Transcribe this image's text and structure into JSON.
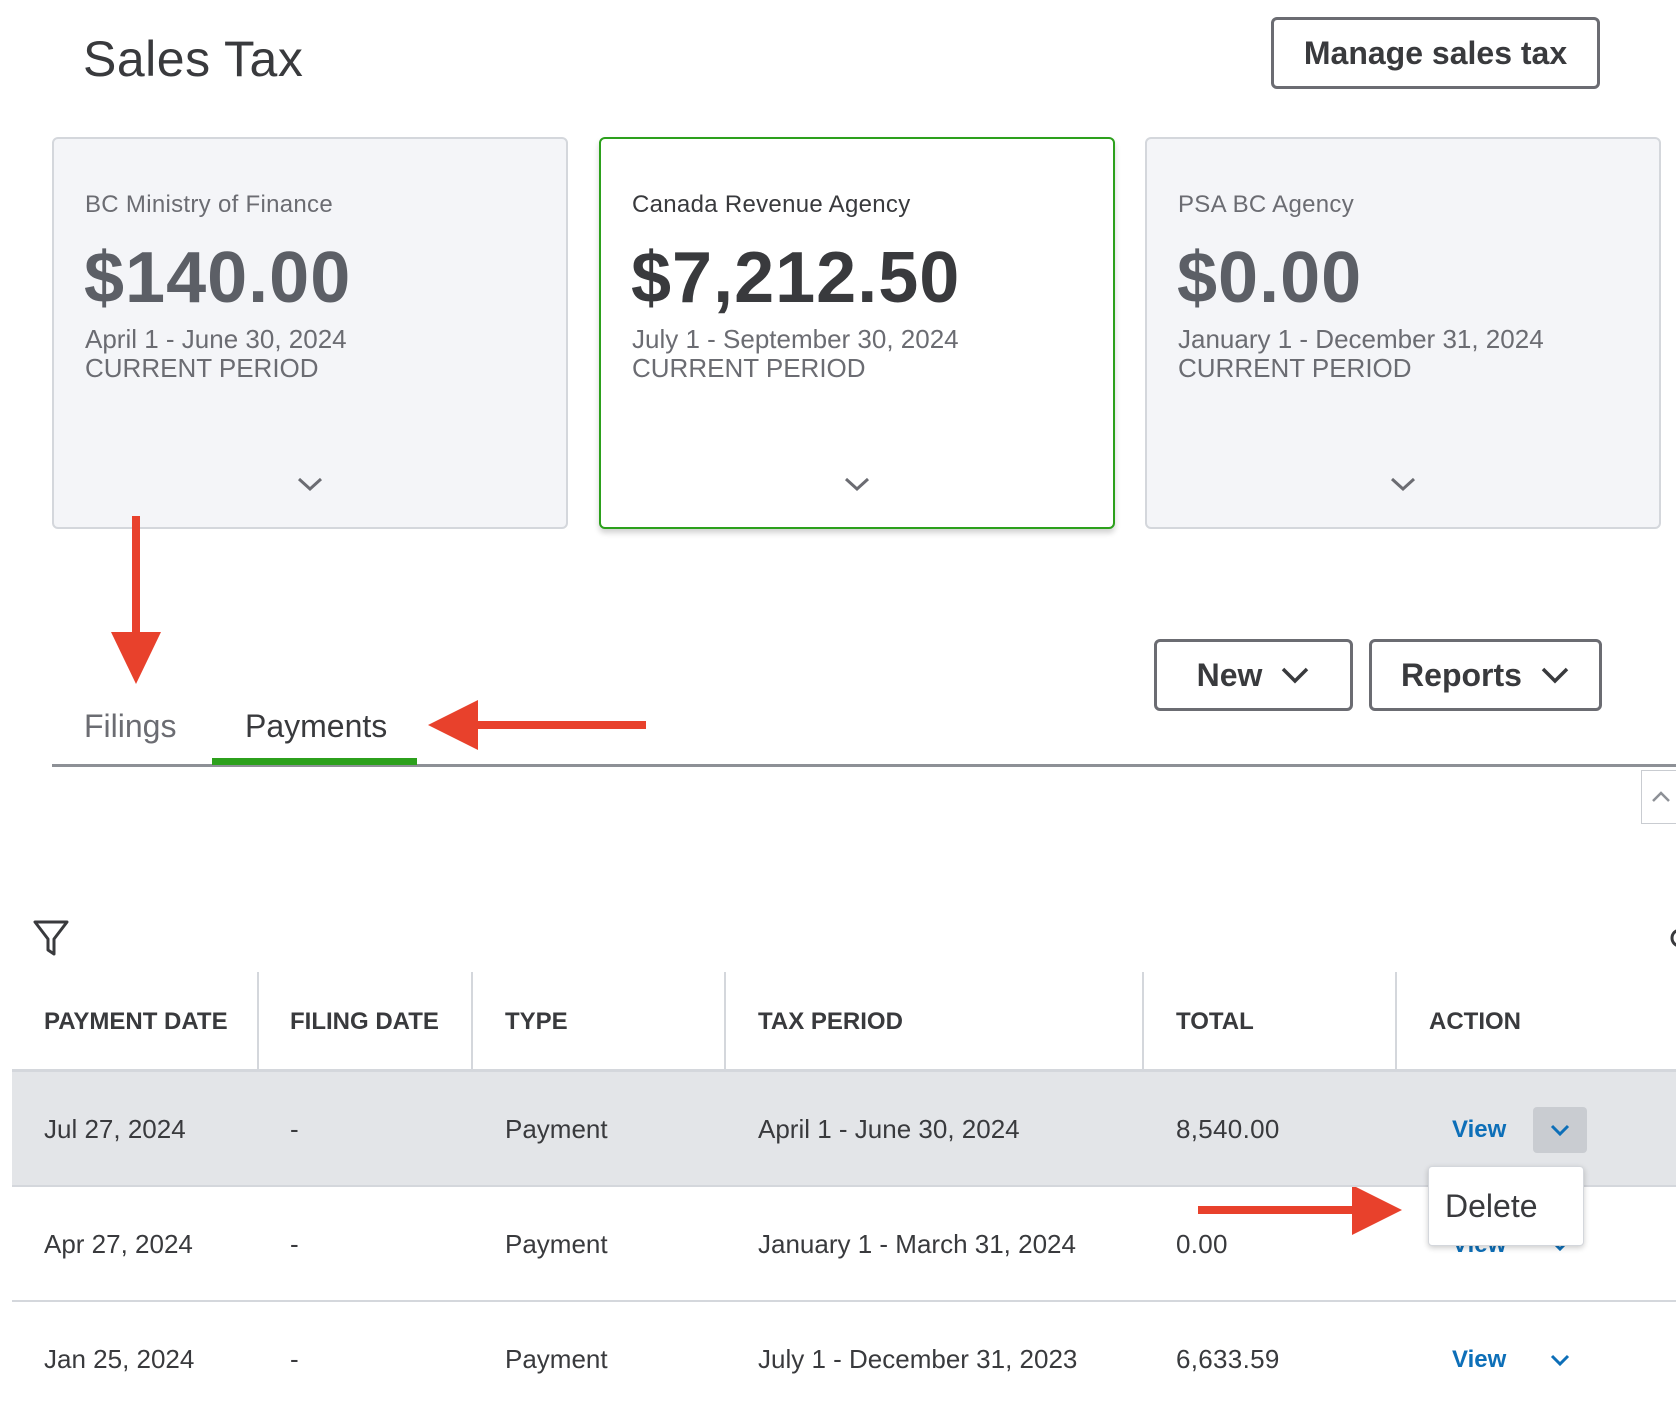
{
  "header": {
    "title": "Sales Tax",
    "manage_label": "Manage sales tax"
  },
  "cards": [
    {
      "agency": "BC Ministry of Finance",
      "amount": "$140.00",
      "period": "April 1 - June 30, 2024",
      "status": "CURRENT PERIOD"
    },
    {
      "agency": "Canada Revenue Agency",
      "amount": "$7,212.50",
      "period": "July 1 - September 30, 2024",
      "status": "CURRENT PERIOD"
    },
    {
      "agency": "PSA BC Agency",
      "amount": "$0.00",
      "period": "January 1 - December 31, 2024",
      "status": "CURRENT PERIOD"
    }
  ],
  "tabs": [
    {
      "label": "Filings"
    },
    {
      "label": "Payments"
    }
  ],
  "toolbar": {
    "new_label": "New",
    "reports_label": "Reports"
  },
  "table": {
    "columns": [
      "PAYMENT DATE",
      "FILING DATE",
      "TYPE",
      "TAX PERIOD",
      "TOTAL",
      "ACTION"
    ],
    "rows": [
      {
        "payment_date": "Jul 27, 2024",
        "filing_date": "-",
        "type": "Payment",
        "tax_period": "April 1 - June 30, 2024",
        "total": "8,540.00",
        "action": "View"
      },
      {
        "payment_date": "Apr 27, 2024",
        "filing_date": "-",
        "type": "Payment",
        "tax_period": "January 1 - March 31, 2024",
        "total": "0.00",
        "action": "View"
      },
      {
        "payment_date": "Jan 25, 2024",
        "filing_date": "-",
        "type": "Payment",
        "tax_period": "July 1 - December 31, 2023",
        "total": "6,633.59",
        "action": "View"
      }
    ]
  },
  "dropdown_menu": {
    "delete_label": "Delete"
  },
  "colors": {
    "accent_green": "#2ca01c",
    "annotation_red": "#e8412c",
    "link_blue": "#0d6fb8"
  }
}
